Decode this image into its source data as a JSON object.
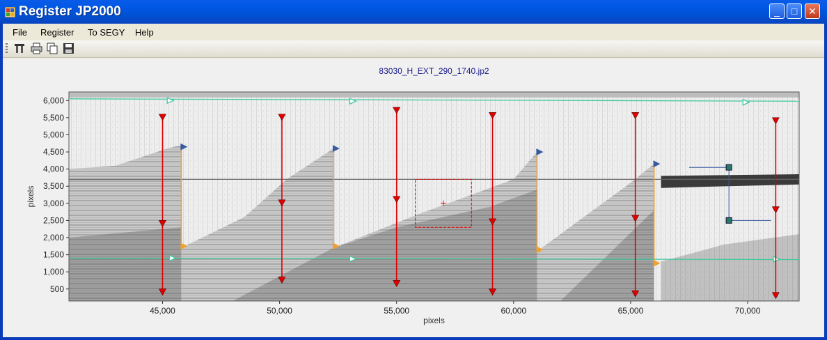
{
  "window": {
    "title": "Register JP2000",
    "controls": {
      "minimize": "_",
      "maximize": "□",
      "close": "✕"
    }
  },
  "menu": {
    "items": [
      "File",
      "Register",
      "To SEGY",
      "Help"
    ]
  },
  "toolbar": {
    "icons": [
      "tools-icon",
      "print-icon",
      "copy-icon",
      "save-icon"
    ]
  },
  "chart_data": {
    "type": "image",
    "title": "83030_H_EXT_290_1740.jp2",
    "xlabel": "pixels",
    "ylabel": "pixels",
    "x_ticks": [
      45000,
      50000,
      55000,
      60000,
      65000,
      70000
    ],
    "x_tick_labels": [
      "45,000",
      "50,000",
      "55,000",
      "60,000",
      "65,000",
      "70,000"
    ],
    "y_ticks": [
      6000,
      5500,
      5000,
      4500,
      4000,
      3500,
      3000,
      2500,
      2000,
      1500,
      1000,
      500
    ],
    "y_tick_labels": [
      "6,000",
      "5,500",
      "5,000",
      "4,500",
      "4,000",
      "3,500",
      "3,000",
      "2,500",
      "2,000",
      "1,500",
      "1,000",
      "500"
    ],
    "xlim": [
      41000,
      72200
    ],
    "ylim": [
      150,
      6250
    ],
    "colors": {
      "red_marker": "#e00000",
      "orange_marker": "#f0a030",
      "blue_marker": "#3a5aa0",
      "green_line": "#40c8a0",
      "dark_marker": "#2a7a6a"
    },
    "horizon_top": {
      "y": [
        6050,
        5980
      ],
      "x": [
        41000,
        72200
      ]
    },
    "horizon_bottom": {
      "y": [
        1400,
        1360
      ],
      "x": [
        41000,
        72200
      ]
    },
    "red_verticals": [
      {
        "x": 45000,
        "y_top": 5500,
        "y_mid": 2400,
        "y_bottom": 400
      },
      {
        "x": 50100,
        "y_top": 5500,
        "y_mid": 3000,
        "y_bottom": 750
      },
      {
        "x": 55000,
        "y_top": 5700,
        "y_mid": 3100,
        "y_bottom": 650
      },
      {
        "x": 59100,
        "y_top": 5550,
        "y_mid": 2450,
        "y_bottom": 400
      },
      {
        "x": 65200,
        "y_top": 5550,
        "y_mid": 2550,
        "y_bottom": 350
      },
      {
        "x": 71200,
        "y_top": 5400,
        "y_mid": 2800,
        "y_bottom": 300
      }
    ],
    "orange_verticals": [
      {
        "x": 45800,
        "y_top": 4650,
        "y_bottom": 1750
      },
      {
        "x": 52300,
        "y_top": 4600,
        "y_bottom": 1750
      },
      {
        "x": 61000,
        "y_top": 4500,
        "y_bottom": 1650
      },
      {
        "x": 66000,
        "y_top": 4150,
        "y_bottom": 1250
      }
    ],
    "green_markers": [
      {
        "x": 45200,
        "y": 6000
      },
      {
        "x": 53000,
        "y": 5980
      },
      {
        "x": 69800,
        "y": 5950
      },
      {
        "x": 45300,
        "y": 1400
      },
      {
        "x": 53000,
        "y": 1380
      },
      {
        "x": 71100,
        "y": 1370
      }
    ],
    "selection_box": {
      "x": [
        55800,
        58200
      ],
      "y": [
        2300,
        3700
      ]
    },
    "crosshair": {
      "x": 57000,
      "y": 3000
    },
    "dark_handles": [
      {
        "x": 69200,
        "y": 4050
      },
      {
        "x": 69200,
        "y": 2500
      }
    ]
  }
}
